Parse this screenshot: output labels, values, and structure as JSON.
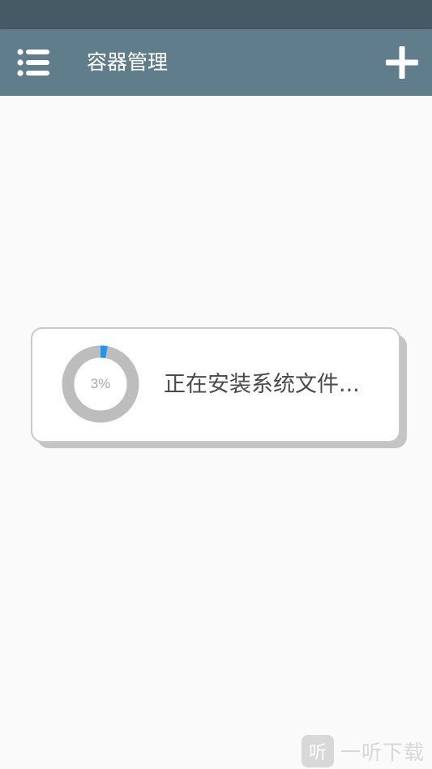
{
  "app_bar": {
    "title": "容器管理",
    "menu_icon": "list-menu-icon",
    "add_icon": "plus-icon",
    "color": "#607d8b",
    "status_bar_color": "#455a64"
  },
  "dialog": {
    "progress_percent": 3,
    "progress_label": "3%",
    "message": "正在安装系统文件...",
    "progress_color": "#2196f3",
    "track_color": "#bdbdbd"
  },
  "watermark": {
    "logo_glyph": "听",
    "text": "一听下载"
  }
}
